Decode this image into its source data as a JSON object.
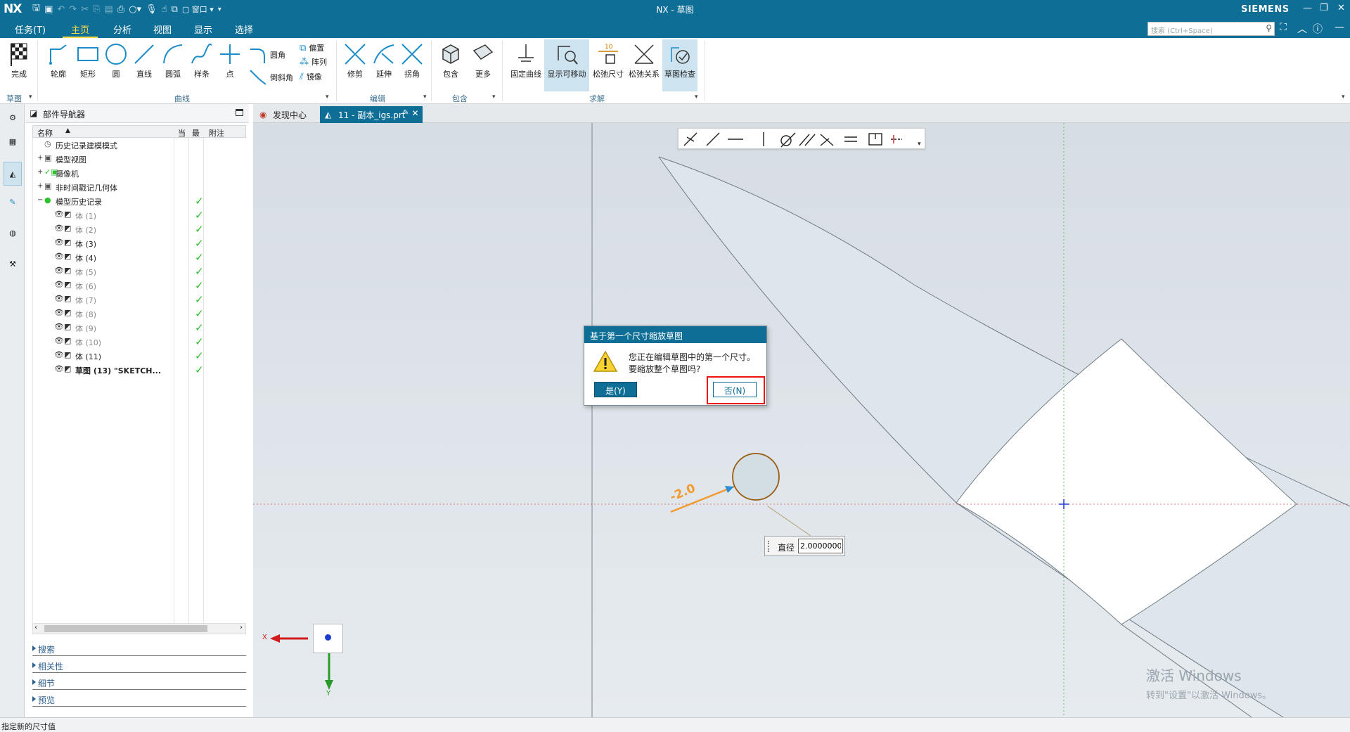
{
  "app": {
    "logo": "NX",
    "title": "NX - 草图",
    "brand": "SIEMENS",
    "window_menu": "窗口"
  },
  "menu": {
    "tabs": [
      "任务(T)",
      "主页",
      "分析",
      "视图",
      "显示",
      "选择"
    ],
    "active_tab": "主页",
    "search_placeholder": "搜索 (Ctrl+Space)"
  },
  "ribbon": {
    "finish": "完成",
    "curve_tools": [
      "轮廓",
      "矩形",
      "圆",
      "直线",
      "圆弧",
      "样条",
      "点"
    ],
    "curve_small": [
      "圆角",
      "倒斜角",
      "偏置",
      "阵列",
      "镜像"
    ],
    "edit_tools": [
      "修剪",
      "延伸",
      "拐角"
    ],
    "include_tools": [
      "包含",
      "更多"
    ],
    "solve_tools": [
      "固定曲线",
      "显示可移动",
      "松弛尺寸",
      "松弛关系",
      "草图检查"
    ],
    "groups": [
      "草图",
      "曲线",
      "编辑",
      "包含",
      "求解"
    ]
  },
  "navigator": {
    "title": "部件导航器",
    "columns": [
      "名称",
      "当",
      "最",
      "附注"
    ],
    "tree": [
      {
        "label": "历史记录建模模式",
        "expander": "",
        "dim": false,
        "check": false
      },
      {
        "label": "模型视图",
        "expander": "+",
        "dim": false,
        "check": false
      },
      {
        "label": "摄像机",
        "expander": "+",
        "dim": false,
        "check": false
      },
      {
        "label": "非时间戳记几何体",
        "expander": "+",
        "dim": false,
        "check": false
      },
      {
        "label": "模型历史记录",
        "expander": "−",
        "dim": false,
        "check": true
      },
      {
        "label": "体 (1)",
        "expander": "",
        "dim": true,
        "check": true
      },
      {
        "label": "体 (2)",
        "expander": "",
        "dim": true,
        "check": true
      },
      {
        "label": "体 (3)",
        "expander": "",
        "dim": false,
        "check": true
      },
      {
        "label": "体 (4)",
        "expander": "",
        "dim": false,
        "check": true
      },
      {
        "label": "体 (5)",
        "expander": "",
        "dim": true,
        "check": true
      },
      {
        "label": "体 (6)",
        "expander": "",
        "dim": true,
        "check": true
      },
      {
        "label": "体 (7)",
        "expander": "",
        "dim": true,
        "check": true
      },
      {
        "label": "体 (8)",
        "expander": "",
        "dim": true,
        "check": true
      },
      {
        "label": "体 (9)",
        "expander": "",
        "dim": true,
        "check": true
      },
      {
        "label": "体 (10)",
        "expander": "",
        "dim": true,
        "check": true
      },
      {
        "label": "体 (11)",
        "expander": "",
        "dim": false,
        "check": true
      },
      {
        "label": "草图 (13) \"SKETCH...",
        "expander": "",
        "dim": false,
        "check": true,
        "bold": true
      }
    ],
    "sections": [
      "搜索",
      "相关性",
      "细节",
      "预览"
    ]
  },
  "doc_tabs": [
    {
      "label": "发现中心",
      "active": false
    },
    {
      "label": "11 - 副本_igs.prt",
      "active": true
    }
  ],
  "dialog": {
    "title": "基于第一个尺寸缩放草图",
    "message_line1": "您正在编辑草图中的第一个尺寸。",
    "message_line2": "要缩放整个草图吗?",
    "yes": "是(Y)",
    "no": "否(N)"
  },
  "dimension": {
    "label": "直径",
    "value": "2.0000000",
    "annotation": "-2.0"
  },
  "axes": {
    "x": "X",
    "y": "Y"
  },
  "watermark": {
    "line1": "激活 Windows",
    "line2": "转到\"设置\"以激活 Windows。"
  },
  "status": {
    "prompt": "指定新的尺寸值"
  },
  "colors": {
    "titlebar": "#0e6e96",
    "accent_tab": "#ffd94a",
    "dim_orange": "#f39a2e",
    "highlight_red": "#e11111",
    "check_green": "#2bc42b"
  }
}
